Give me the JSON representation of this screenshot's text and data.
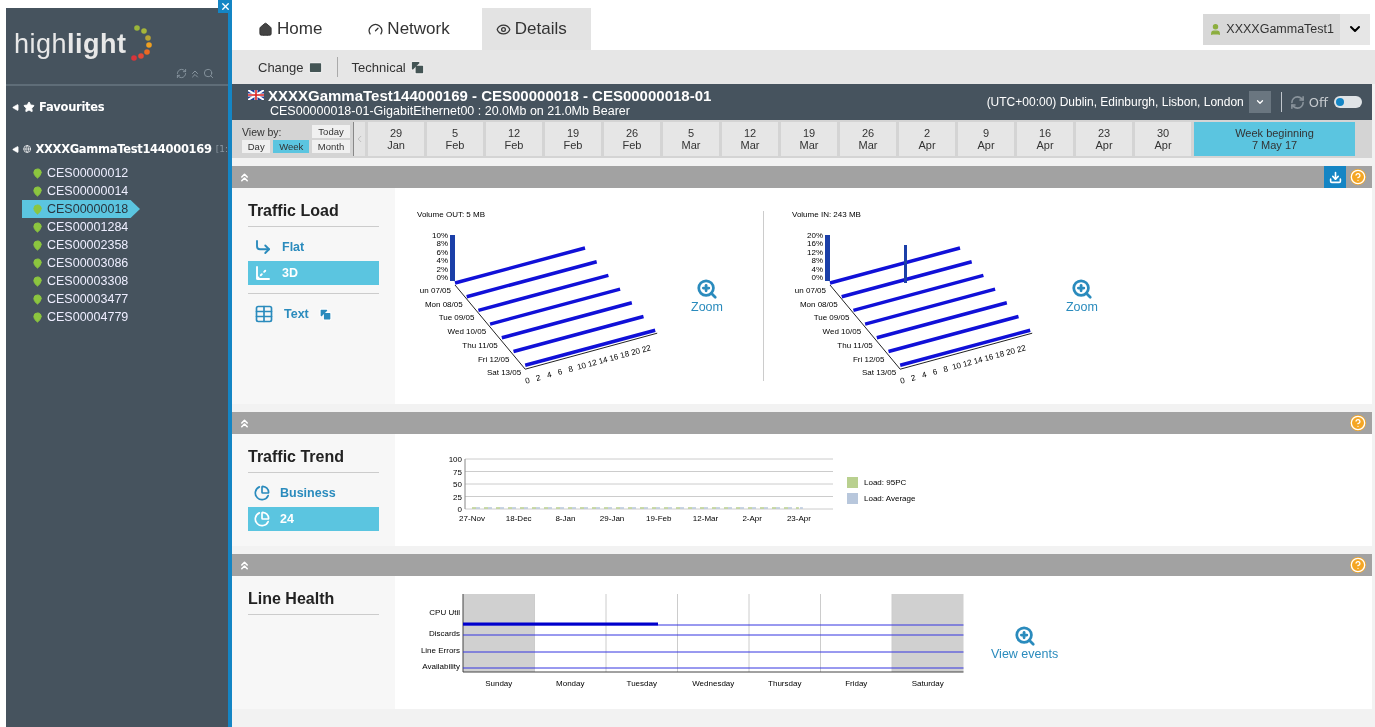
{
  "sidebar": {
    "logo": {
      "light": "high",
      "bold": "light"
    },
    "tree": [
      {
        "label": "Favourites",
        "kind": "favourites",
        "expanded": true
      },
      {
        "label": "XXXXGammaTest144000169",
        "suffix": "[1:",
        "kind": "group",
        "expanded": true,
        "children": [
          {
            "label": "CES00000012",
            "selected": false
          },
          {
            "label": "CES00000014",
            "selected": false
          },
          {
            "label": "CES00000018",
            "selected": true
          },
          {
            "label": "CES00001284",
            "selected": false
          },
          {
            "label": "CES00002358",
            "selected": false
          },
          {
            "label": "CES00003086",
            "selected": false
          },
          {
            "label": "CES00003308",
            "selected": false
          },
          {
            "label": "CES00003477",
            "selected": false
          },
          {
            "label": "CES00004779",
            "selected": false
          }
        ]
      }
    ]
  },
  "tabs": [
    {
      "label": "Home",
      "kind": "home",
      "selected": false
    },
    {
      "label": "Network",
      "kind": "network",
      "selected": false
    },
    {
      "label": "Details",
      "kind": "details",
      "selected": true
    }
  ],
  "user": {
    "name": "XXXXGammaTest1"
  },
  "toolbar": [
    {
      "label": "Change",
      "kind": "mail"
    },
    {
      "label": "Technical",
      "kind": "windows"
    }
  ],
  "header": {
    "title": "XXXXGammaTest144000169 - CES00000018 - CES00000018-01",
    "subtitle": "CES00000018-01-GigabitEthernet00 : 20.0Mb on 21.0Mb Bearer",
    "timezone": "(UTC+00:00) Dublin, Edinburgh, Lisbon, London",
    "refresh_label": "Off",
    "refresh_on": false
  },
  "view_by": {
    "label": "View by:",
    "today": "Today",
    "modes": [
      {
        "label": "Day",
        "selected": false
      },
      {
        "label": "Week",
        "selected": true
      },
      {
        "label": "Month",
        "selected": false
      }
    ]
  },
  "weeks": [
    {
      "day": "29",
      "month": "Jan",
      "selected": false
    },
    {
      "day": "5",
      "month": "Feb",
      "selected": false
    },
    {
      "day": "12",
      "month": "Feb",
      "selected": false
    },
    {
      "day": "19",
      "month": "Feb",
      "selected": false
    },
    {
      "day": "26",
      "month": "Feb",
      "selected": false
    },
    {
      "day": "5",
      "month": "Mar",
      "selected": false
    },
    {
      "day": "12",
      "month": "Mar",
      "selected": false
    },
    {
      "day": "19",
      "month": "Mar",
      "selected": false
    },
    {
      "day": "26",
      "month": "Mar",
      "selected": false
    },
    {
      "day": "2",
      "month": "Apr",
      "selected": false
    },
    {
      "day": "9",
      "month": "Apr",
      "selected": false
    },
    {
      "day": "16",
      "month": "Apr",
      "selected": false
    },
    {
      "day": "23",
      "month": "Apr",
      "selected": false
    },
    {
      "day": "30",
      "month": "Apr",
      "selected": false
    },
    {
      "day": "Week beginning",
      "month": "7 May 17",
      "selected": true
    }
  ],
  "sections": [
    {
      "kind": "traffic_load",
      "title": "Traffic Load",
      "download": true,
      "options": [
        {
          "label": "Flat",
          "kind": "flat",
          "selected": false
        },
        {
          "label": "3D",
          "kind": "cube",
          "selected": true
        },
        {
          "label": "Text",
          "kind": "text",
          "selected": false
        }
      ],
      "charts": [
        {
          "title": "Volume OUT: 5 MB",
          "yticks": [
            "10%",
            "8%",
            "6%",
            "4%",
            "2%",
            "0%"
          ],
          "peak": false,
          "days": [
            "un 07/05",
            "Mon 08/05",
            "Tue 09/05",
            "Wed 10/05",
            "Thu 11/05",
            "Fri 12/05",
            "Sat 13/05"
          ],
          "hours": [
            "0",
            "2",
            "4",
            "6",
            "8",
            "10",
            "12",
            "14",
            "16",
            "18",
            "20",
            "22"
          ],
          "zoom_label": "Zoom"
        },
        {
          "title": "Volume IN: 243 MB",
          "yticks": [
            "20%",
            "16%",
            "12%",
            "8%",
            "4%",
            "0%"
          ],
          "peak": true,
          "days": [
            "un 07/05",
            "Mon 08/05",
            "Tue 09/05",
            "Wed 10/05",
            "Thu 11/05",
            "Fri 12/05",
            "Sat 13/05"
          ],
          "hours": [
            "0",
            "2",
            "4",
            "6",
            "8",
            "10",
            "12",
            "14",
            "16",
            "18",
            "20",
            "22"
          ],
          "zoom_label": "Zoom"
        }
      ]
    },
    {
      "kind": "traffic_trend",
      "title": "Traffic Trend",
      "options": [
        {
          "label": "Business",
          "kind": "pie",
          "selected": false
        },
        {
          "label": "24",
          "kind": "pie",
          "selected": true
        }
      ],
      "chart_data": {
        "type": "line",
        "categories": [
          "27-Nov",
          "18-Dec",
          "8-Jan",
          "29-Jan",
          "19-Feb",
          "12-Mar",
          "2-Apr",
          "23-Apr"
        ],
        "ylim": [
          0,
          100
        ],
        "yticks": [
          0,
          25,
          50,
          75,
          100
        ],
        "grid": true,
        "legend": true,
        "series": [
          {
            "name": "Load: 95PC",
            "color": "#b9d08f",
            "line_style": "dashed",
            "values": [
              0,
              0,
              0,
              0,
              0,
              0,
              0,
              0
            ]
          },
          {
            "name": "Load: Average",
            "color": "#b8c7dc",
            "line_style": "dashed",
            "values": [
              0,
              0,
              0,
              0,
              0,
              0,
              0,
              0
            ]
          }
        ]
      }
    },
    {
      "kind": "line_health",
      "title": "Line Health",
      "rows": [
        {
          "label": "CPU Util"
        },
        {
          "label": "Discards"
        },
        {
          "label": "Line Errors"
        },
        {
          "label": "Availability"
        }
      ],
      "days": [
        {
          "label": "Sunday",
          "shaded": true
        },
        {
          "label": "Monday",
          "shaded": false
        },
        {
          "label": "Tuesday",
          "shaded": false
        },
        {
          "label": "Wednesday",
          "shaded": false
        },
        {
          "label": "Thursday",
          "shaded": false
        },
        {
          "label": "Friday",
          "shaded": false
        },
        {
          "label": "Saturday",
          "shaded": true
        }
      ],
      "events_label": "View events"
    }
  ]
}
